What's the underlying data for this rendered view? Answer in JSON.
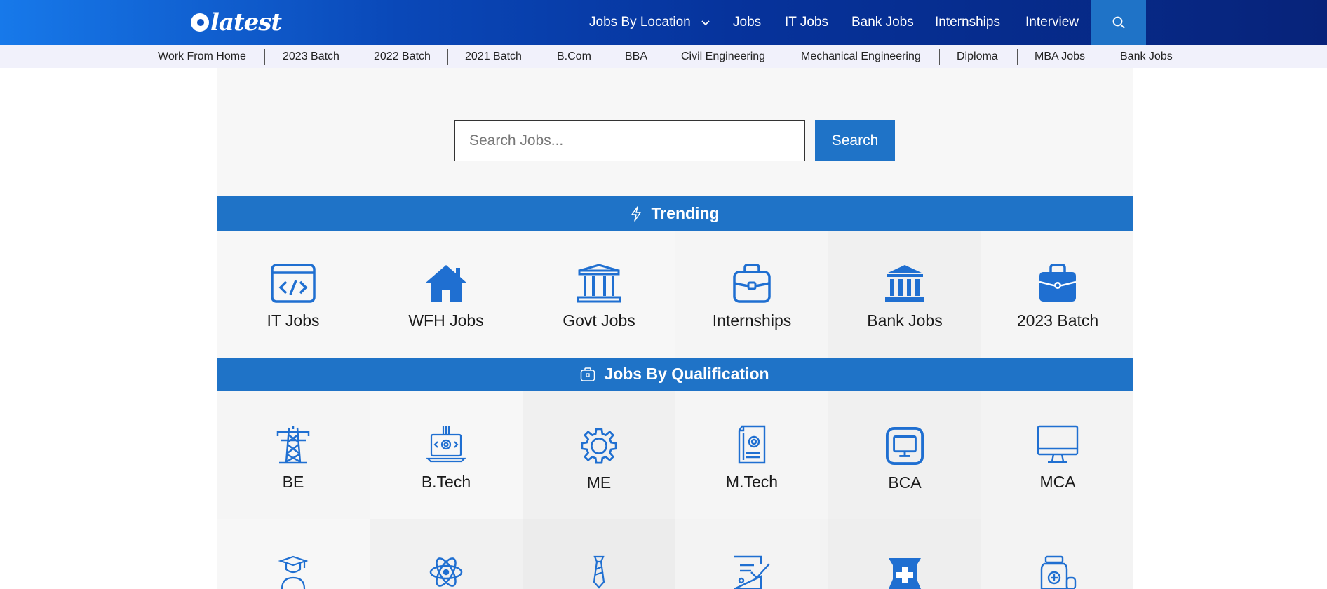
{
  "header": {
    "logo_text": "latest",
    "nav": [
      {
        "label": "Jobs By Location",
        "has_dropdown": true
      },
      {
        "label": "Jobs"
      },
      {
        "label": "IT Jobs"
      },
      {
        "label": "Bank Jobs"
      },
      {
        "label": "Internships"
      },
      {
        "label": "Interview"
      }
    ],
    "search_icon": "search-icon"
  },
  "subnav": [
    "Work From Home",
    "2023 Batch",
    "2022 Batch",
    "2021 Batch",
    "B.Com",
    "BBA",
    "Civil Engineering",
    "Mechanical Engineering",
    "Diploma",
    "MBA Jobs",
    "Bank Jobs"
  ],
  "search": {
    "placeholder": "Search Jobs...",
    "button_label": "Search"
  },
  "trending": {
    "title": "Trending",
    "icon": "lightning-icon",
    "items": [
      {
        "label": "IT Jobs",
        "icon": "code-window-icon"
      },
      {
        "label": "WFH Jobs",
        "icon": "home-icon"
      },
      {
        "label": "Govt Jobs",
        "icon": "government-building-icon"
      },
      {
        "label": "Internships",
        "icon": "briefcase-outline-icon"
      },
      {
        "label": "Bank Jobs",
        "icon": "bank-icon"
      },
      {
        "label": "2023 Batch",
        "icon": "briefcase-filled-icon"
      }
    ]
  },
  "qualification": {
    "title": "Jobs By Qualification",
    "icon": "briefcase-small-icon",
    "items": [
      {
        "label": "BE",
        "icon": "power-tower-icon"
      },
      {
        "label": "B.Tech",
        "icon": "laptop-gear-icon"
      },
      {
        "label": "ME",
        "icon": "gear-icon"
      },
      {
        "label": "M.Tech",
        "icon": "document-gear-icon"
      },
      {
        "label": "BCA",
        "icon": "monitor-square-icon"
      },
      {
        "label": "MCA",
        "icon": "desktop-monitor-icon"
      }
    ],
    "row2_icons": [
      "graduate-icon",
      "atom-icon",
      "necktie-icon",
      "checklist-icon",
      "mortar-pestle-icon",
      "medicine-bottle-icon"
    ]
  },
  "colors": {
    "accent": "#1f73c7",
    "icon_blue": "#1f6fd1",
    "header_dark": "#07237a"
  }
}
